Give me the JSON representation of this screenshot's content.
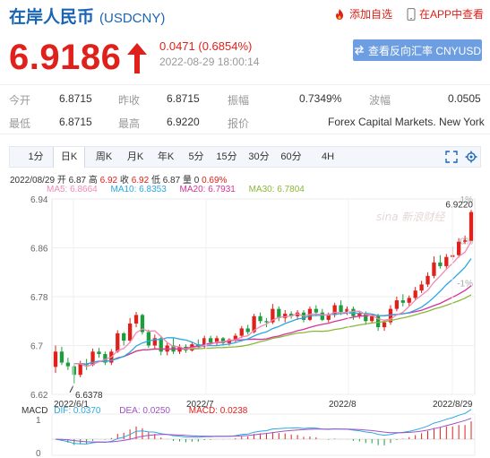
{
  "header": {
    "title": "在岸人民币",
    "code": "(USDCNY)",
    "add_favorite": "添加自选",
    "view_in_app": "在APP中查看"
  },
  "quote": {
    "price": "6.9186",
    "change": "0.0471 (0.6854%)",
    "time": "2022-08-29 18:00:14",
    "reverse_button": "查看反向汇率 CNYUSD"
  },
  "stats": {
    "open_label": "今开",
    "open": "6.8715",
    "prev_close_label": "昨收",
    "prev_close": "6.8715",
    "amplitude_label": "振幅",
    "amplitude": "0.7349%",
    "volatility_label": "波幅",
    "volatility": "0.0505",
    "low_label": "最低",
    "low": "6.8715",
    "high_label": "最高",
    "high": "6.9220",
    "quote_label": "报价",
    "quote_source": "Forex Capital Markets. New York"
  },
  "tabs": [
    "1分",
    "日K",
    "周K",
    "月K",
    "年K",
    "5分",
    "15分",
    "30分",
    "60分",
    "4H"
  ],
  "active_tab": "日K",
  "ohlc_bar": {
    "date": "2022/08/29",
    "open_label": "开",
    "open": "6.87",
    "high_label": "高",
    "high": "6.92",
    "close_label": "收",
    "close": "6.92",
    "low_label": "低",
    "low": "6.87",
    "volume_label": "量",
    "volume": "0",
    "change_pct": "0.69%"
  },
  "ma": {
    "ma5": "MA5: 6.8664",
    "ma10": "MA10: 6.8353",
    "ma20": "MA20: 6.7931",
    "ma30": "MA30: 6.7804"
  },
  "macd": {
    "label": "MACD",
    "dif": "DIF: 0.0370",
    "dea": "DEA: 0.0250",
    "macd": "MACD: 0.0238"
  },
  "colors": {
    "up": "#e0201a",
    "down": "#1c9e3c",
    "ma5": "#f08ab4",
    "ma10": "#2aa9e0",
    "ma20": "#d6339a",
    "ma30": "#8ab83a",
    "brand": "#1a64b5"
  },
  "chart_data": {
    "type": "candlestick",
    "y_ticks": [
      "6.94",
      "6.86",
      "6.78",
      "6.7",
      "6.62"
    ],
    "right_ticks": [
      "2%",
      "1%",
      "0%",
      "-1%"
    ],
    "x_ticks": [
      "2022/6/1",
      "2022/7",
      "2022/8",
      "2022/8/29"
    ],
    "max_label": "6.9220",
    "min_label": "6.6378",
    "ylim": [
      6.62,
      6.94
    ],
    "macd_ticks": [
      "1",
      "0"
    ],
    "watermark": "sina 新浪财经",
    "candles": [
      [
        6.665,
        6.69,
        6.7,
        6.655
      ],
      [
        6.69,
        6.672,
        6.698,
        6.668
      ],
      [
        6.672,
        6.666,
        6.68,
        6.66
      ],
      [
        6.666,
        6.652,
        6.668,
        6.638
      ],
      [
        6.652,
        6.67,
        6.675,
        6.648
      ],
      [
        6.67,
        6.668,
        6.678,
        6.66
      ],
      [
        6.668,
        6.69,
        6.695,
        6.666
      ],
      [
        6.69,
        6.686,
        6.696,
        6.68
      ],
      [
        6.686,
        6.672,
        6.69,
        6.668
      ],
      [
        6.672,
        6.69,
        6.694,
        6.668
      ],
      [
        6.69,
        6.72,
        6.725,
        6.688
      ],
      [
        6.72,
        6.708,
        6.722,
        6.7
      ],
      [
        6.708,
        6.736,
        6.745,
        6.704
      ],
      [
        6.736,
        6.75,
        6.755,
        6.73
      ],
      [
        6.75,
        6.722,
        6.752,
        6.718
      ],
      [
        6.722,
        6.7,
        6.726,
        6.696
      ],
      [
        6.7,
        6.712,
        6.718,
        6.695
      ],
      [
        6.712,
        6.69,
        6.716,
        6.684
      ],
      [
        6.69,
        6.7,
        6.705,
        6.684
      ],
      [
        6.7,
        6.69,
        6.712,
        6.686
      ],
      [
        6.69,
        6.698,
        6.702,
        6.686
      ],
      [
        6.698,
        6.692,
        6.702,
        6.688
      ],
      [
        6.692,
        6.702,
        6.706,
        6.69
      ],
      [
        6.702,
        6.698,
        6.71,
        6.694
      ],
      [
        6.698,
        6.712,
        6.716,
        6.696
      ],
      [
        6.712,
        6.705,
        6.716,
        6.7
      ],
      [
        6.705,
        6.712,
        6.716,
        6.7
      ],
      [
        6.712,
        6.704,
        6.714,
        6.7
      ],
      [
        6.704,
        6.71,
        6.712,
        6.7
      ],
      [
        6.71,
        6.716,
        6.72,
        6.706
      ],
      [
        6.716,
        6.728,
        6.732,
        6.712
      ],
      [
        6.728,
        6.722,
        6.734,
        6.718
      ],
      [
        6.722,
        6.748,
        6.752,
        6.72
      ],
      [
        6.748,
        6.74,
        6.754,
        6.736
      ],
      [
        6.74,
        6.738,
        6.745,
        6.73
      ],
      [
        6.738,
        6.76,
        6.768,
        6.735
      ],
      [
        6.76,
        6.745,
        6.764,
        6.74
      ],
      [
        6.745,
        6.752,
        6.758,
        6.738
      ],
      [
        6.752,
        6.748,
        6.756,
        6.744
      ],
      [
        6.748,
        6.754,
        6.758,
        6.742
      ],
      [
        6.754,
        6.742,
        6.758,
        6.738
      ],
      [
        6.742,
        6.76,
        6.764,
        6.74
      ],
      [
        6.76,
        6.754,
        6.766,
        6.748
      ],
      [
        6.754,
        6.742,
        6.76,
        6.74
      ],
      [
        6.742,
        6.75,
        6.754,
        6.738
      ],
      [
        6.75,
        6.766,
        6.77,
        6.746
      ],
      [
        6.766,
        6.755,
        6.774,
        6.75
      ],
      [
        6.755,
        6.76,
        6.764,
        6.75
      ],
      [
        6.76,
        6.748,
        6.764,
        6.742
      ],
      [
        6.748,
        6.752,
        6.756,
        6.744
      ],
      [
        6.752,
        6.74,
        6.756,
        6.734
      ],
      [
        6.74,
        6.748,
        6.752,
        6.736
      ],
      [
        6.748,
        6.73,
        6.752,
        6.724
      ],
      [
        6.73,
        6.738,
        6.742,
        6.724
      ],
      [
        6.738,
        6.76,
        6.766,
        6.734
      ],
      [
        6.76,
        6.774,
        6.78,
        6.756
      ],
      [
        6.774,
        6.77,
        6.784,
        6.764
      ],
      [
        6.77,
        6.778,
        6.782,
        6.764
      ],
      [
        6.778,
        6.79,
        6.796,
        6.774
      ],
      [
        6.79,
        6.8,
        6.806,
        6.786
      ],
      [
        6.8,
        6.814,
        6.82,
        6.796
      ],
      [
        6.814,
        6.836,
        6.846,
        6.81
      ],
      [
        6.836,
        6.83,
        6.848,
        6.826
      ],
      [
        6.83,
        6.845,
        6.85,
        6.826
      ],
      [
        6.845,
        6.848,
        6.862,
        6.84
      ],
      [
        6.848,
        6.87,
        6.876,
        6.844
      ],
      [
        6.87,
        6.872,
        6.88,
        6.866
      ],
      [
        6.8715,
        6.9186,
        6.922,
        6.8715
      ]
    ]
  }
}
